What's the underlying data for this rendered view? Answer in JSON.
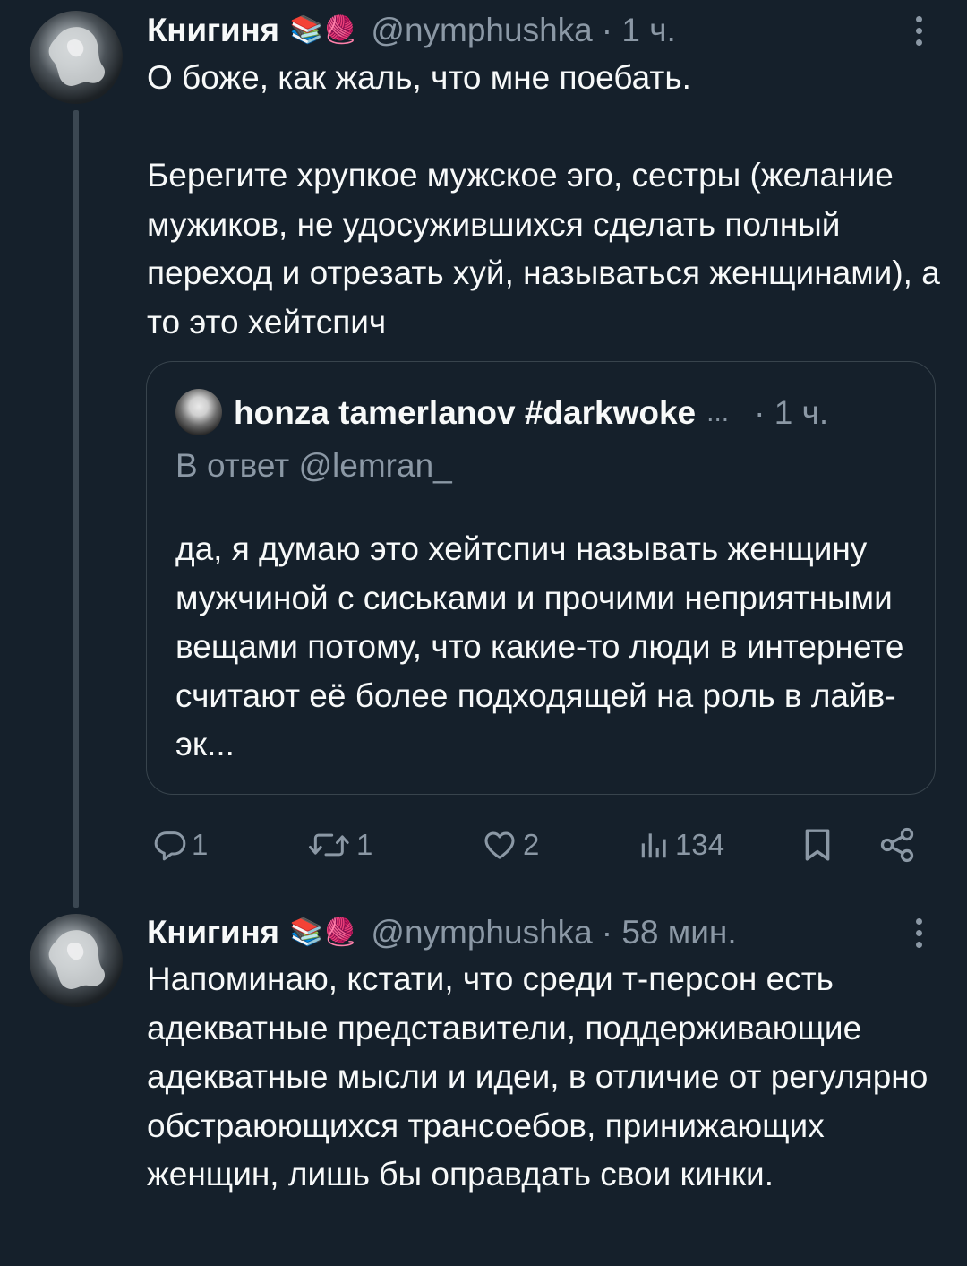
{
  "tweet1": {
    "name": "Книгиня",
    "emoji": "📚🧶",
    "handle": "@nymphushka",
    "time": "· 1 ч.",
    "text": "О боже, как жаль, что мне поебать.\n\nБерегите хрупкое мужское эго, сестры (желание мужиков, не удосужившихся сделать полный переход и отрезать хуй, называться женщинами), а то это хейтспич",
    "quote": {
      "name": "honza tamerlanov #darkwoke",
      "ellipsis": "...",
      "time": "· 1 ч.",
      "reply_to": "В ответ @lemran_",
      "text": "да, я думаю это хейтспич называть женщину мужчиной с сиськами и прочими неприятными вещами потому, что какие-то люди в интернете считают её более подходящей на роль в лайв-эк..."
    },
    "actions": {
      "replies": "1",
      "retweets": "1",
      "likes": "2",
      "views": "134"
    }
  },
  "tweet2": {
    "name": "Книгиня",
    "emoji": "📚🧶",
    "handle": "@nymphushka",
    "time": "· 58 мин.",
    "text": "Напоминаю, кстати, что среди т-персон есть адекватные представители, поддерживающие адекватные мысли и идеи, в отличие от регулярно обстраюющихся трансоебов, принижающих женщин, лишь бы оправдать свои кинки."
  },
  "colors": {
    "background": "#15202b",
    "text": "#f7f9f9",
    "muted": "#8b98a5",
    "border": "#38444d"
  },
  "icons": [
    "reply-icon",
    "retweet-icon",
    "like-icon",
    "views-icon",
    "bookmark-icon",
    "share-icon",
    "more-icon"
  ]
}
